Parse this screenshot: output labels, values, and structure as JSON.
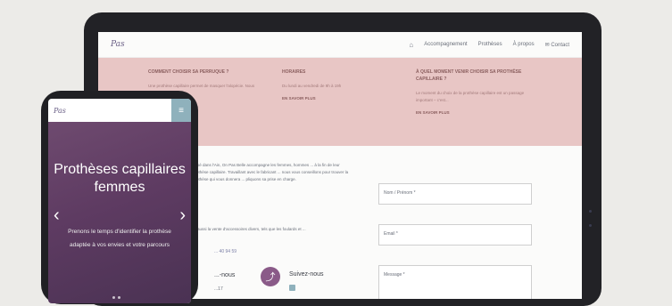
{
  "tablet": {
    "nav": {
      "logo": "Pas",
      "home_icon": "home-icon",
      "items": [
        "Accompagnement",
        "Prothèses",
        "À propos",
        "✉ Contact"
      ]
    },
    "pink_band": {
      "columns": [
        {
          "title": "COMMENT CHOISIR SA PERRUQUE ?",
          "text": "Une prothèse capillaire permet de masquer l'alopécie. Nous sommes...",
          "more": ""
        },
        {
          "title": "HORAIRES",
          "text": "Du lundi au vendredi de 9h à 19h",
          "more": "EN SAVOIR PLUS"
        },
        {
          "title": "À QUEL MOMENT VENIR CHOISIR SA PROTHÈSE CAPILLAIRE ?",
          "text": "Le moment du choix de la prothèse capillaire est un passage important – c'est...",
          "more": "EN SAVOIR PLUS"
        }
      ]
    },
    "content": {
      "intro": "basé dans l'Ain, On Pas Belle accompagne les femmes, hommes ... à la fin de leur prothèse capillaire. Travaillant avec le fabricant ... nous vous conseillons pour trouver la prothèse qui vous donnera ... pliquons sa prise en charge.",
      "intro2": "... aussi la vente d'accessoires divers, tels que les foulards et ...",
      "link": "... 40 94 59",
      "contact_title": "...-nous",
      "contact_line": "...17",
      "follow": "Suivez-nous",
      "share_icon": "share-icon",
      "facebook_icon": "facebook-icon"
    },
    "form": {
      "name_placeholder": "Nom / Prénom *",
      "email_placeholder": "Email *",
      "message_placeholder": "Message *"
    }
  },
  "phone": {
    "logo": "Pas",
    "menu_icon": "menu-icon",
    "hero_title": "Prothèses capillaires femmes",
    "hero_text": "Prenons le temps d'identifier la prothèse adaptée à vos envies et votre parcours",
    "prev_icon": "chevron-left-icon",
    "next_icon": "chevron-right-icon"
  }
}
